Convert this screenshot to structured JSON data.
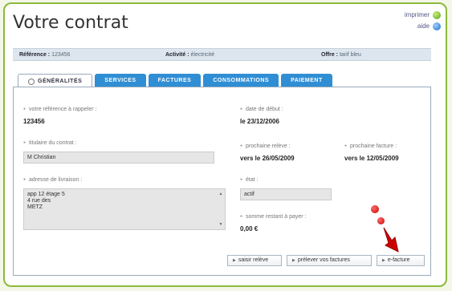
{
  "page": {
    "title": "Votre contrat"
  },
  "toplinks": {
    "print": "imprimer",
    "help": "aide"
  },
  "infobar": {
    "ref_label": "Référence :",
    "ref_value": "123456",
    "activity_label": "Activité :",
    "activity_value": "électricité",
    "offer_label": "Offre :",
    "offer_value": "tarif bleu"
  },
  "tabs": [
    "GÉNÉRALITÉS",
    "SERVICES",
    "FACTURES",
    "CONSOMMATIONS",
    "PAIEMENT"
  ],
  "fields": {
    "ref_recall_label": "votre référence à rappeler :",
    "ref_recall_value": "123456",
    "holder_label": "titulaire du contrat :",
    "holder_value": "M Christian",
    "address_label": "adresse de livraison :",
    "address_lines": [
      "app 12 étage 5",
      "4 rue des",
      "METZ"
    ],
    "start_label": "date de début :",
    "start_value": "le 23/12/2006",
    "next_reading_label": "prochaine relève :",
    "next_reading_value": "vers le 26/05/2009",
    "next_invoice_label": "prochaine facture :",
    "next_invoice_value": "vers le 12/05/2009",
    "status_label": "état :",
    "status_value": "actif",
    "due_label": "somme restant à payer :",
    "due_value": "0,00 €"
  },
  "buttons": {
    "reading": "saisir relève",
    "debit": "prélever vos factures",
    "einvoice": "e-facture"
  },
  "colors": {
    "tab_blue": "#2f8ed4",
    "frame_green": "#8cb93b",
    "arrow_red": "#cc0000"
  }
}
